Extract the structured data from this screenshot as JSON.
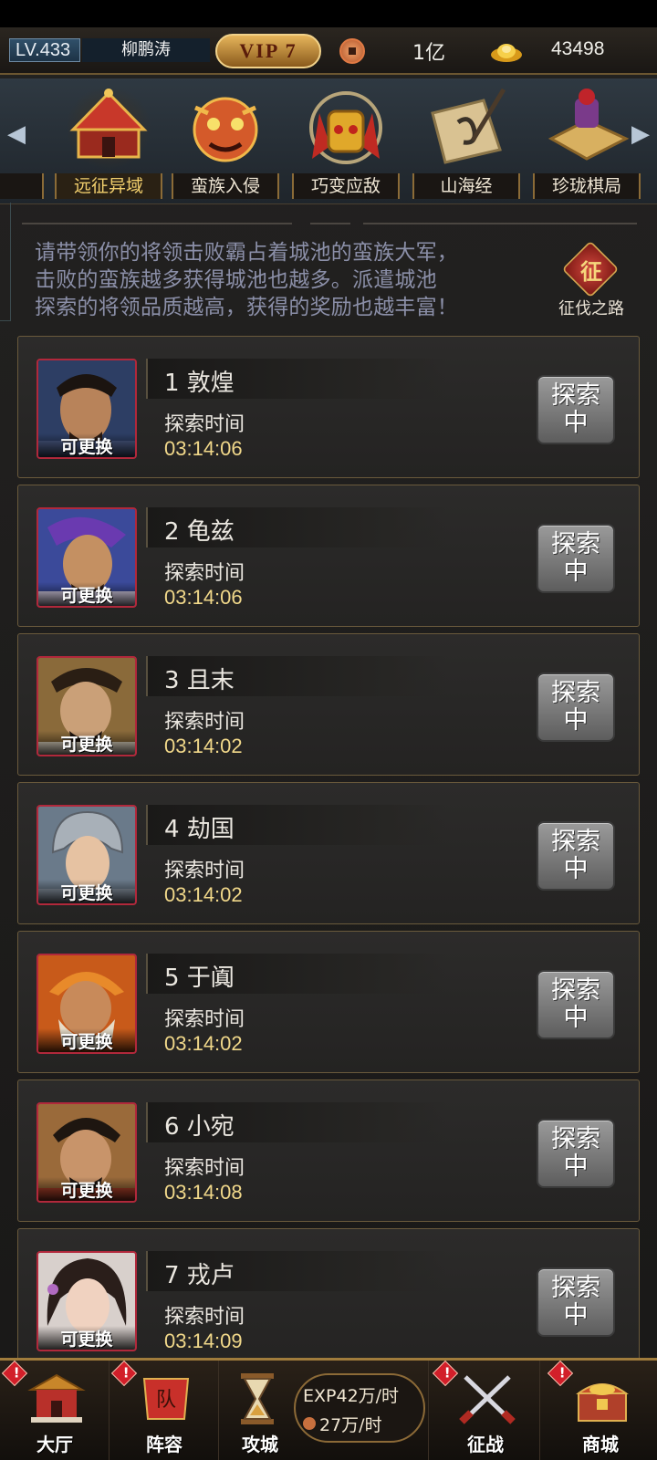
{
  "header": {
    "level": "LV.433",
    "player_name": "柳鹏涛",
    "vip": "VIP 7",
    "copper": "1亿",
    "gold": "43498"
  },
  "tabs": [
    {
      "label": "远征异域",
      "icon": "red-tent-icon",
      "active": true
    },
    {
      "label": "蛮族入侵",
      "icon": "demon-mask-icon",
      "active": false
    },
    {
      "label": "巧变应敌",
      "icon": "helmet-emblem-icon",
      "active": false
    },
    {
      "label": "山海经",
      "icon": "scroll-brush-icon",
      "active": false
    },
    {
      "label": "珍珑棋局",
      "icon": "chessboard-icon",
      "active": false
    }
  ],
  "description": {
    "line1": "请带领你的将领击败霸占着城池的蛮族大军，",
    "line2": "击败的蛮族越多获得城池也越多。派遣城池",
    "line3": "探索的将领品质越高，获得的奖励也越丰富！"
  },
  "road_button": {
    "char": "征",
    "label": "征伐之路"
  },
  "missions": [
    {
      "name": "1 敦煌",
      "time_label": "探索时间",
      "timer": "03:14:06",
      "swap": "可更换",
      "button": "探索\n中"
    },
    {
      "name": "2 龟兹",
      "time_label": "探索时间",
      "timer": "03:14:06",
      "swap": "可更换",
      "button": "探索\n中"
    },
    {
      "name": "3 且末",
      "time_label": "探索时间",
      "timer": "03:14:02",
      "swap": "可更换",
      "button": "探索\n中"
    },
    {
      "name": "4 劫国",
      "time_label": "探索时间",
      "timer": "03:14:02",
      "swap": "可更换",
      "button": "探索\n中"
    },
    {
      "name": "5 于阗",
      "time_label": "探索时间",
      "timer": "03:14:02",
      "swap": "可更换",
      "button": "探索\n中"
    },
    {
      "name": "6 小宛",
      "time_label": "探索时间",
      "timer": "03:14:08",
      "swap": "可更换",
      "button": "探索\n中"
    },
    {
      "name": "7 戎卢",
      "time_label": "探索时间",
      "timer": "03:14:09",
      "swap": "可更换",
      "button": "探索\n中"
    }
  ],
  "bottom_nav": {
    "hall": "大厅",
    "lineup": "阵容",
    "lineup_icon_char": "队",
    "siege": "攻城",
    "exp_rate": "EXP42万/时",
    "coin_rate": "27万/时",
    "campaign": "征战",
    "shop": "商城",
    "badge": "!"
  },
  "colors": {
    "accent_gold": "#f1d88a",
    "border_red": "#b1283b",
    "desc_text": "#8b8fa8"
  }
}
